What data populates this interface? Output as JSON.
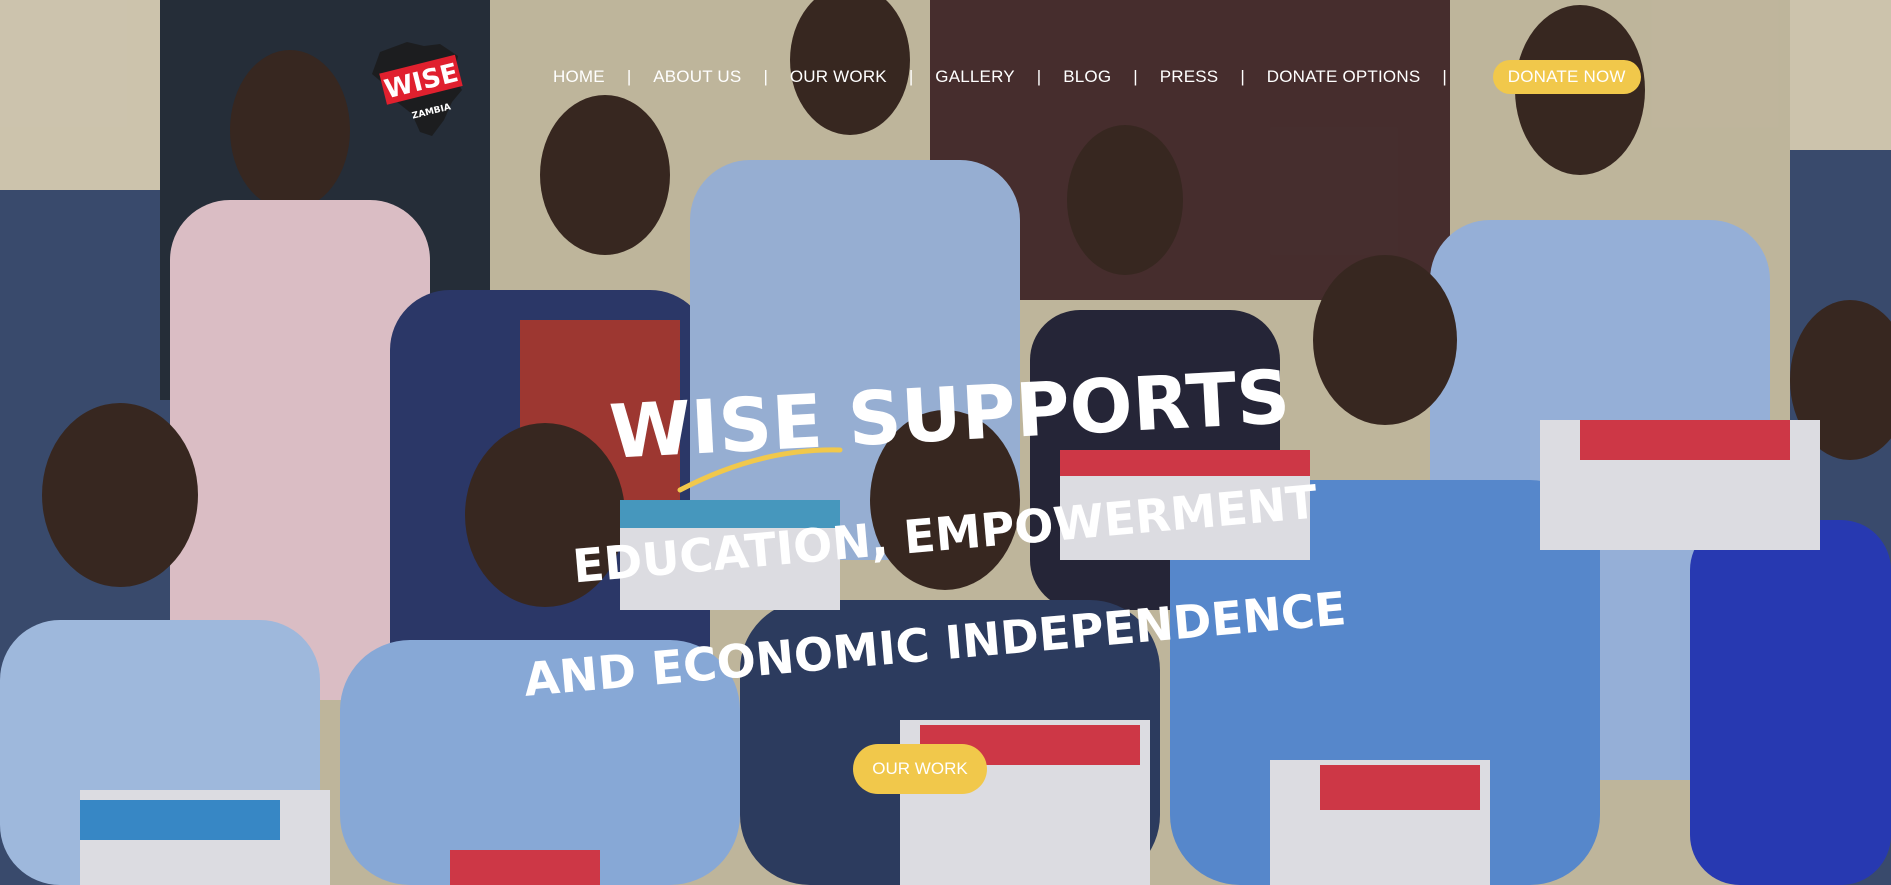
{
  "logo": {
    "word": "WISE",
    "subtitle": "ZAMBIA"
  },
  "nav": {
    "items": [
      {
        "label": "HOME"
      },
      {
        "label": "ABOUT US"
      },
      {
        "label": "OUR WORK"
      },
      {
        "label": "GALLERY"
      },
      {
        "label": "BLOG"
      },
      {
        "label": "PRESS"
      },
      {
        "label": "DONATE OPTIONS"
      }
    ],
    "separator": "|",
    "donate_label": "DONATE NOW"
  },
  "hero": {
    "line1": "WISE SUPPORTS",
    "line2": "EDUCATION, EMPOWERMENT",
    "line3": "AND ECONOMIC INDEPENDENCE",
    "cta_label": "OUR WORK"
  },
  "colors": {
    "accent": "#f1c84b",
    "logo_red": "#e0202e",
    "text": "#ffffff"
  }
}
